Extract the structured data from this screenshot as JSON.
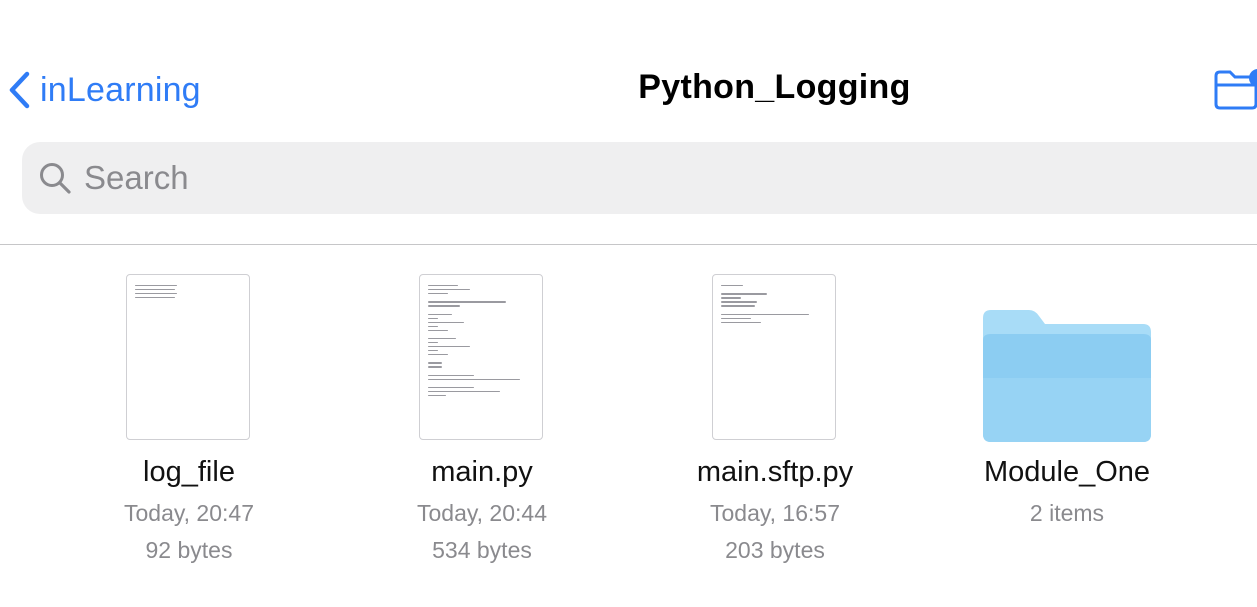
{
  "nav": {
    "back_label": "inLearning",
    "title": "Python_Logging"
  },
  "search": {
    "placeholder": "Search"
  },
  "colors": {
    "accent": "#2f7cf6",
    "folder_light": "#a8dcf7",
    "folder_dark": "#8ccdf2"
  },
  "files": [
    {
      "name": "log_file",
      "date": "Today, 20:47",
      "size": "92 bytes",
      "icon": "document-thumbnail-icon"
    },
    {
      "name": "main.py",
      "date": "Today, 20:44",
      "size": "534 bytes",
      "icon": "document-thumbnail-icon"
    },
    {
      "name": "main.sftp.py",
      "date": "Today, 16:57",
      "size": "203 bytes",
      "icon": "document-thumbnail-icon"
    },
    {
      "name": "Module_One",
      "count": "2 items",
      "icon": "folder-icon"
    }
  ]
}
